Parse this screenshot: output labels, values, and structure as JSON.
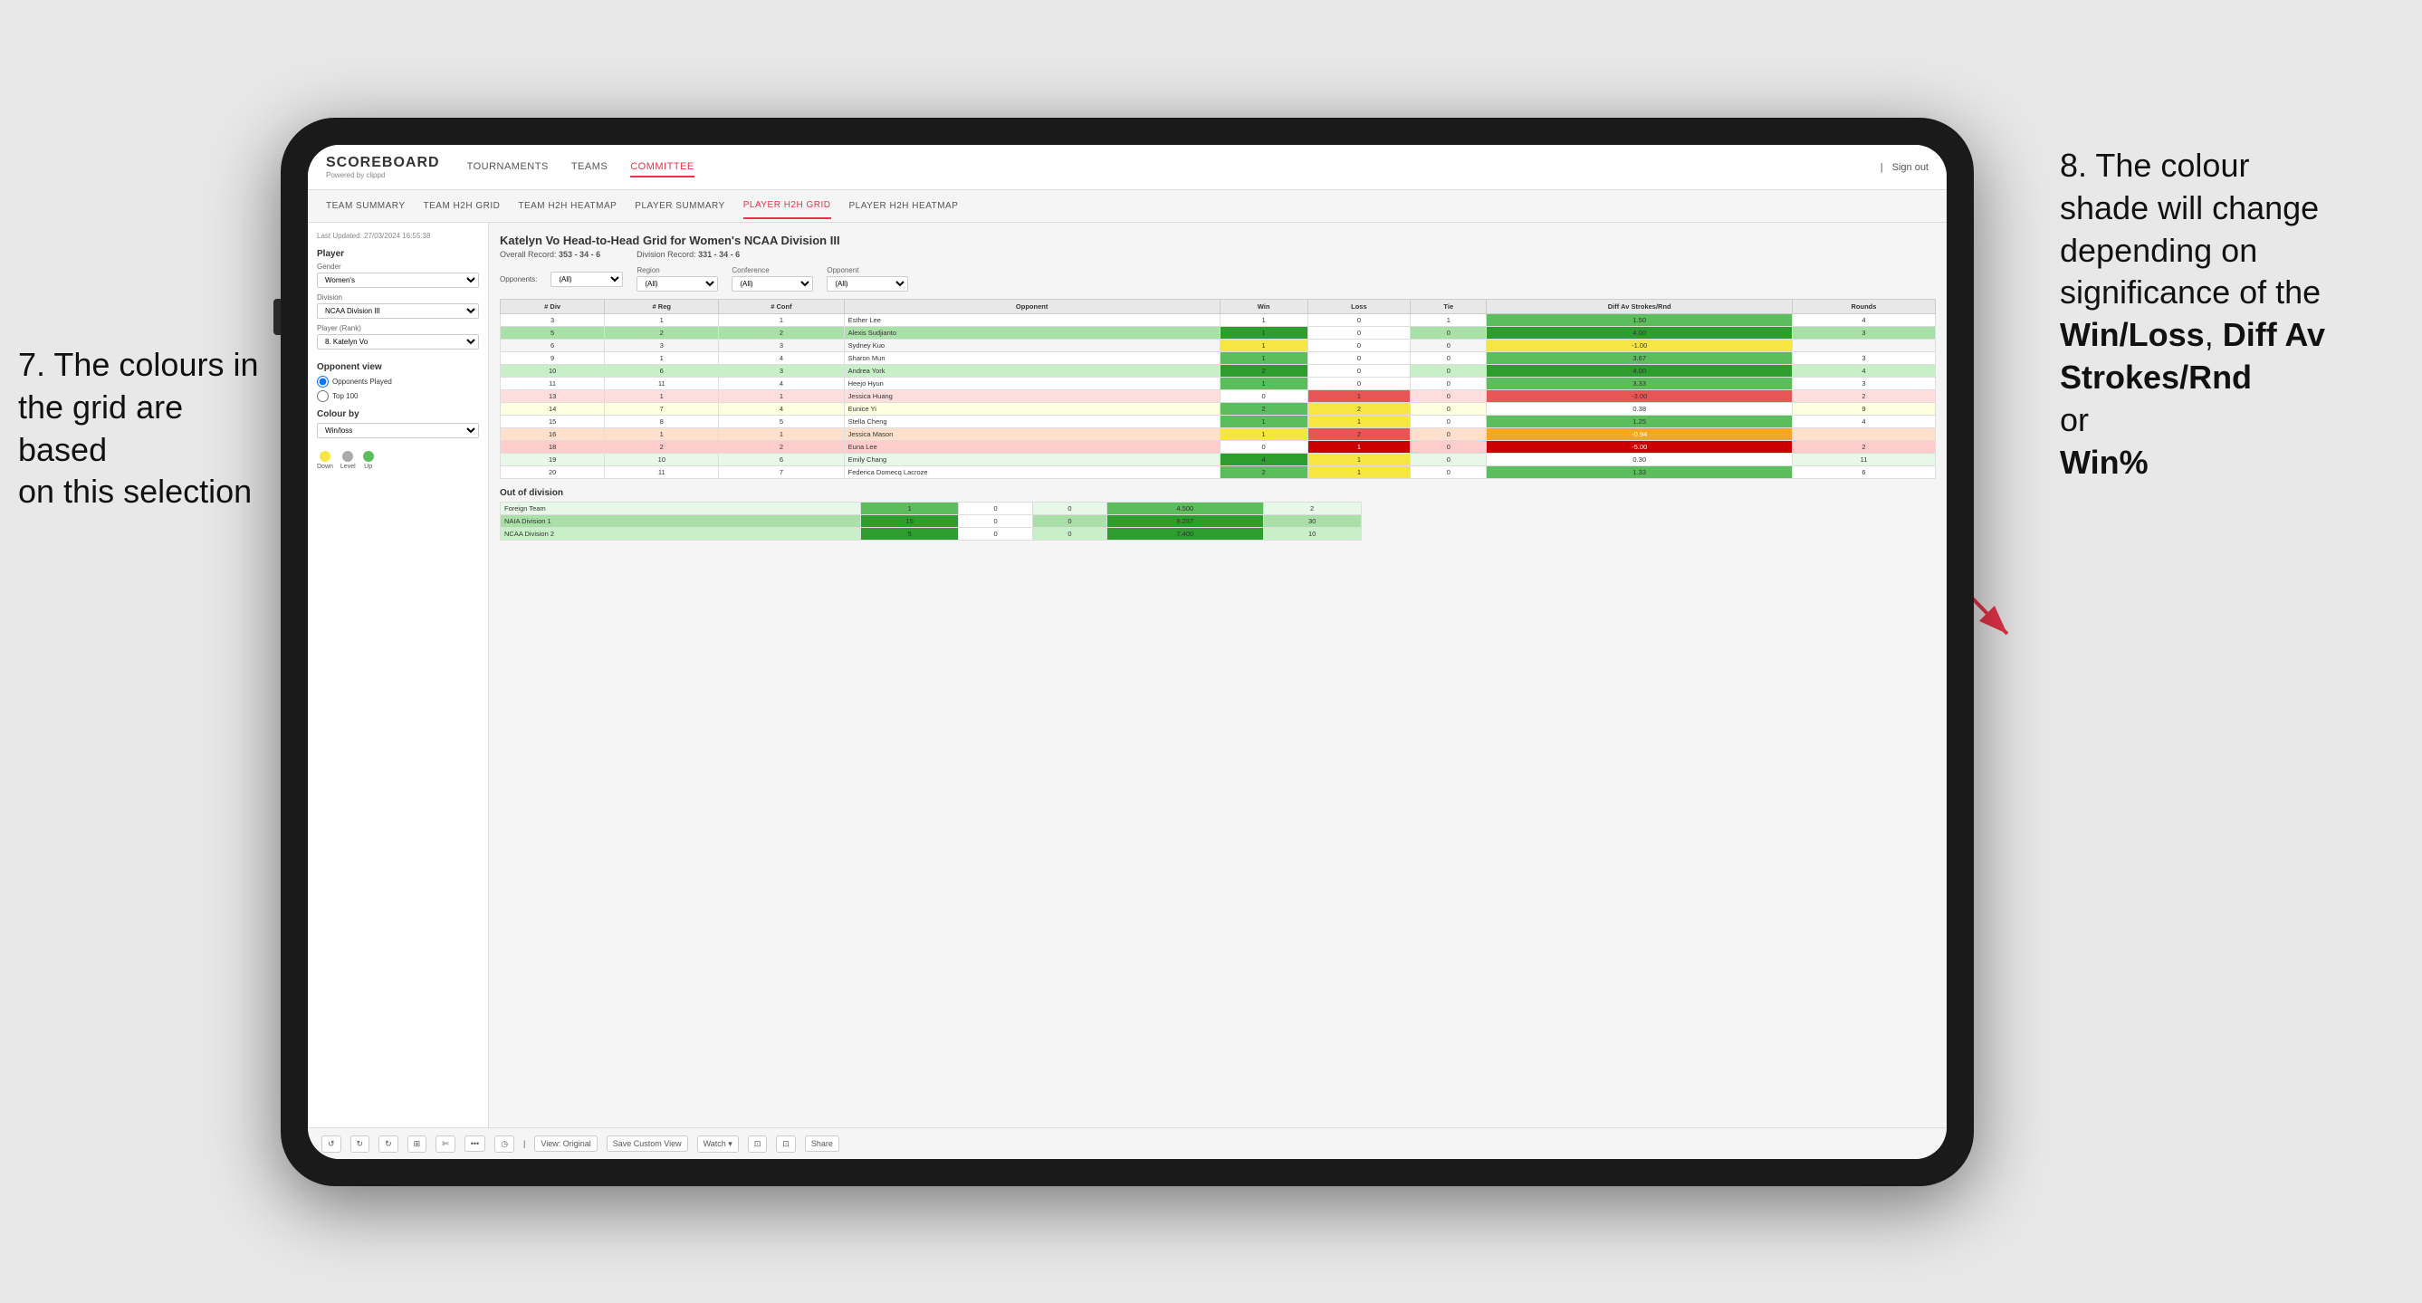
{
  "annotations": {
    "left": {
      "line1": "7. The colours in",
      "line2": "the grid are based",
      "line3": "on this selection"
    },
    "right": {
      "line1": "8. The colour",
      "line2": "shade will change",
      "line3": "depending on",
      "line4": "significance of the",
      "bold1": "Win/Loss",
      "comma1": ", ",
      "bold2": "Diff Av",
      "line5": "Strokes/Rnd",
      "line6": "or",
      "bold3": "Win%"
    }
  },
  "tablet": {
    "nav": {
      "logo": "SCOREBOARD",
      "logo_sub": "Powered by clippd",
      "items": [
        "TOURNAMENTS",
        "TEAMS",
        "COMMITTEE"
      ],
      "active_item": "COMMITTEE",
      "right_items": [
        "Sign out"
      ]
    },
    "sub_nav": {
      "items": [
        "TEAM SUMMARY",
        "TEAM H2H GRID",
        "TEAM H2H HEATMAP",
        "PLAYER SUMMARY",
        "PLAYER H2H GRID",
        "PLAYER H2H HEATMAP"
      ],
      "active_item": "PLAYER H2H GRID"
    },
    "left_panel": {
      "last_updated": "Last Updated: 27/03/2024 16:55:38",
      "section_player": "Player",
      "gender_label": "Gender",
      "gender_value": "Women's",
      "division_label": "Division",
      "division_value": "NCAA Division III",
      "player_rank_label": "Player (Rank)",
      "player_rank_value": "8. Katelyn Vo",
      "opponent_view_label": "Opponent view",
      "radio1": "Opponents Played",
      "radio2": "Top 100",
      "colour_by_label": "Colour by",
      "colour_by_value": "Win/loss",
      "legend": {
        "down_label": "Down",
        "level_label": "Level",
        "up_label": "Up"
      }
    },
    "grid": {
      "title": "Katelyn Vo Head-to-Head Grid for Women's NCAA Division III",
      "overall_record_label": "Overall Record:",
      "overall_record": "353 - 34 - 6",
      "division_record_label": "Division Record:",
      "division_record": "331 - 34 - 6",
      "filters": {
        "opponents_label": "Opponents:",
        "opponents_value": "(All)",
        "region_label": "Region",
        "region_value": "(All)",
        "conference_label": "Conference",
        "conference_value": "(All)",
        "opponent_label": "Opponent",
        "opponent_value": "(All)"
      },
      "table_headers": [
        "# Div",
        "# Reg",
        "# Conf",
        "Opponent",
        "Win",
        "Loss",
        "Tie",
        "Diff Av Strokes/Rnd",
        "Rounds"
      ],
      "rows": [
        {
          "div": "3",
          "reg": "1",
          "conf": "1",
          "opponent": "Esther Lee",
          "win": "1",
          "loss": "0",
          "tie": "1",
          "diff": "1.50",
          "rounds": "4",
          "win_color": "white",
          "loss_color": "white",
          "row_color": "green-light"
        },
        {
          "div": "5",
          "reg": "2",
          "conf": "2",
          "opponent": "Alexis Sudjianto",
          "win": "1",
          "loss": "0",
          "tie": "0",
          "diff": "4.00",
          "rounds": "3",
          "win_color": "green-med",
          "loss_color": "white",
          "row_color": "green-dark"
        },
        {
          "div": "6",
          "reg": "3",
          "conf": "3",
          "opponent": "Sydney Kuo",
          "win": "1",
          "loss": "0",
          "tie": "0",
          "diff": "-1.00",
          "rounds": "",
          "win_color": "yellow",
          "loss_color": "white",
          "row_color": "yellow"
        },
        {
          "div": "9",
          "reg": "1",
          "conf": "4",
          "opponent": "Sharon Mun",
          "win": "1",
          "loss": "0",
          "tie": "0",
          "diff": "3.67",
          "rounds": "3",
          "win_color": "green",
          "loss_color": "white",
          "row_color": "green-light"
        },
        {
          "div": "10",
          "reg": "6",
          "conf": "3",
          "opponent": "Andrea York",
          "win": "2",
          "loss": "0",
          "tie": "0",
          "diff": "4.00",
          "rounds": "4",
          "win_color": "green-dark",
          "loss_color": "white",
          "row_color": "green-med"
        },
        {
          "div": "11",
          "reg": "11",
          "conf": "4",
          "opponent": "Heejo Hyun",
          "win": "1",
          "loss": "0",
          "tie": "0",
          "diff": "3.33",
          "rounds": "3",
          "win_color": "green",
          "loss_color": "white",
          "row_color": "green-light"
        },
        {
          "div": "13",
          "reg": "1",
          "conf": "1",
          "opponent": "Jessica Huang",
          "win": "0",
          "loss": "1",
          "tie": "0",
          "diff": "-3.00",
          "rounds": "2",
          "win_color": "white",
          "loss_color": "red",
          "row_color": "red"
        },
        {
          "div": "14",
          "reg": "7",
          "conf": "4",
          "opponent": "Eunice Yi",
          "win": "2",
          "loss": "2",
          "tie": "0",
          "diff": "0.38",
          "rounds": "9",
          "win_color": "green",
          "loss_color": "yellow",
          "row_color": "yellow"
        },
        {
          "div": "15",
          "reg": "8",
          "conf": "5",
          "opponent": "Stella Cheng",
          "win": "1",
          "loss": "1",
          "tie": "0",
          "diff": "1.25",
          "rounds": "4",
          "win_color": "green",
          "loss_color": "yellow",
          "row_color": "green-light"
        },
        {
          "div": "16",
          "reg": "1",
          "conf": "1",
          "opponent": "Jessica Mason",
          "win": "1",
          "loss": "2",
          "tie": "0",
          "diff": "-0.94",
          "rounds": "",
          "win_color": "yellow",
          "loss_color": "red",
          "row_color": "orange"
        },
        {
          "div": "18",
          "reg": "2",
          "conf": "2",
          "opponent": "Euna Lee",
          "win": "0",
          "loss": "1",
          "tie": "0",
          "diff": "-5.00",
          "rounds": "2",
          "win_color": "white",
          "loss_color": "red-dark",
          "row_color": "red"
        },
        {
          "div": "19",
          "reg": "10",
          "conf": "6",
          "opponent": "Emily Chang",
          "win": "4",
          "loss": "1",
          "tie": "0",
          "diff": "0.30",
          "rounds": "11",
          "win_color": "green-dark",
          "loss_color": "yellow",
          "row_color": "green-light"
        },
        {
          "div": "20",
          "reg": "11",
          "conf": "7",
          "opponent": "Federica Domecq Lacroze",
          "win": "2",
          "loss": "1",
          "tie": "0",
          "diff": "1.33",
          "rounds": "6",
          "win_color": "green",
          "loss_color": "yellow",
          "row_color": "green-light"
        }
      ],
      "out_of_division_label": "Out of division",
      "out_of_division_rows": [
        {
          "opponent": "Foreign Team",
          "win": "1",
          "loss": "0",
          "tie": "0",
          "diff": "4.500",
          "rounds": "2",
          "row_color": "green-med"
        },
        {
          "opponent": "NAIA Division 1",
          "win": "15",
          "loss": "0",
          "tie": "0",
          "diff": "9.267",
          "rounds": "30",
          "row_color": "green-dark"
        },
        {
          "opponent": "NCAA Division 2",
          "win": "5",
          "loss": "0",
          "tie": "0",
          "diff": "7.400",
          "rounds": "10",
          "row_color": "green-med"
        }
      ]
    },
    "toolbar": {
      "buttons": [
        "↺",
        "↻",
        "↻",
        "⊞",
        "✄",
        "·",
        "◷",
        "|",
        "View: Original",
        "Save Custom View",
        "Watch ▾",
        "⊡",
        "⊡",
        "Share"
      ]
    }
  }
}
